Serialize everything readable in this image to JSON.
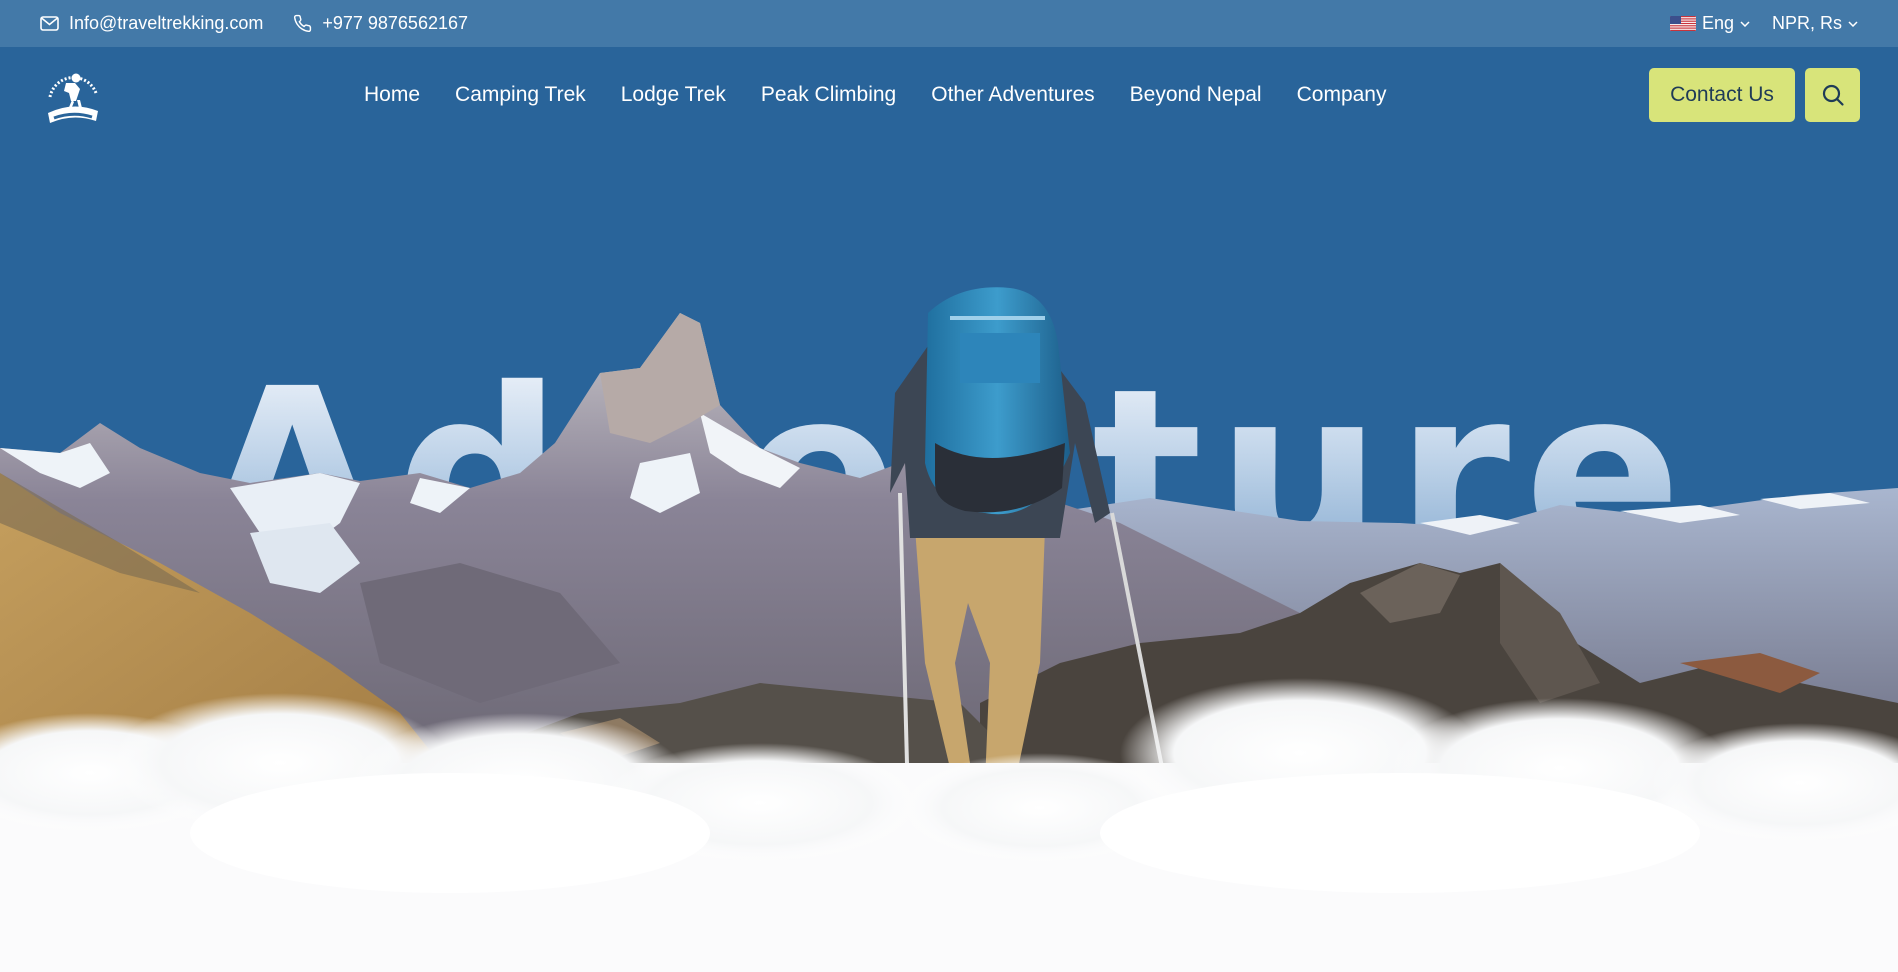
{
  "topbar": {
    "email": "Info@traveltrekking.com",
    "phone": "+977 9876562167",
    "language": "Eng",
    "currency": "NPR, Rs",
    "icons": [
      "mail-icon",
      "phone-icon",
      "us-flag-icon",
      "chevron-down-icon"
    ]
  },
  "logo": {
    "text": "TREKKING",
    "arc_text": "THE BEST ADVENTURE AND HOLIDAYS"
  },
  "nav": {
    "items": [
      {
        "label": "Home"
      },
      {
        "label": "Camping Trek"
      },
      {
        "label": "Lodge Trek"
      },
      {
        "label": "Peak Climbing"
      },
      {
        "label": "Other Adventures"
      },
      {
        "label": "Beyond Nepal"
      },
      {
        "label": "Company"
      }
    ],
    "contact_label": "Contact Us",
    "search_icon": "search-icon"
  },
  "hero": {
    "title": "Adventure"
  },
  "colors": {
    "topbar_bg": "#4379a8",
    "nav_bg": "#29649a",
    "accent": "#d8e47a",
    "accent_text": "#1f3b57"
  }
}
